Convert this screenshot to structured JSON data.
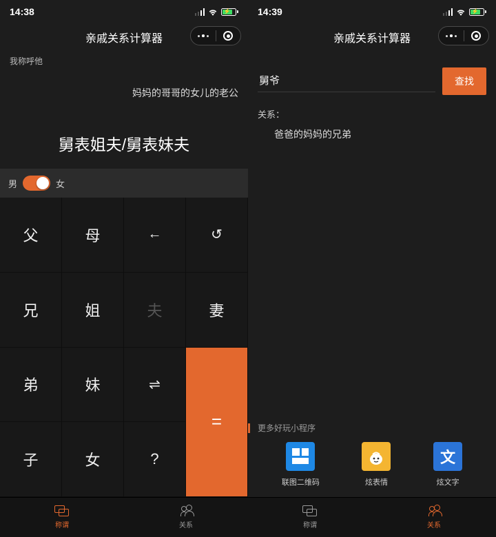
{
  "left": {
    "status": {
      "time": "14:38"
    },
    "title": "亲戚关系计算器",
    "prompt": "我称呼他",
    "chain": "妈妈的哥哥的女儿的老公",
    "result": "舅表姐夫/舅表妹夫",
    "gender": {
      "male": "男",
      "female": "女"
    },
    "keys": {
      "r1c1": "父",
      "r1c2": "母",
      "r1c3": "←",
      "r1c4": "↺",
      "r2c1": "兄",
      "r2c2": "姐",
      "r2c3": "夫",
      "r2c4": "妻",
      "r3c1": "弟",
      "r3c2": "妹",
      "r3c3": "⇌",
      "r4c1": "子",
      "r4c2": "女",
      "r4c3": "?",
      "eq": "="
    },
    "tabs": {
      "chengwei": "称谓",
      "guanxi": "关系"
    }
  },
  "right": {
    "status": {
      "time": "14:39"
    },
    "title": "亲戚关系计算器",
    "search": {
      "value": "舅爷",
      "button": "查找"
    },
    "relation": {
      "label": "关系：",
      "value": "爸爸的妈妈的兄弟"
    },
    "more_label": "更多好玩小程序",
    "apps": [
      {
        "name": "联图二维码"
      },
      {
        "name": "炫表情"
      },
      {
        "name": "炫文字",
        "glyph": "文"
      }
    ],
    "tabs": {
      "chengwei": "称谓",
      "guanxi": "关系"
    }
  }
}
